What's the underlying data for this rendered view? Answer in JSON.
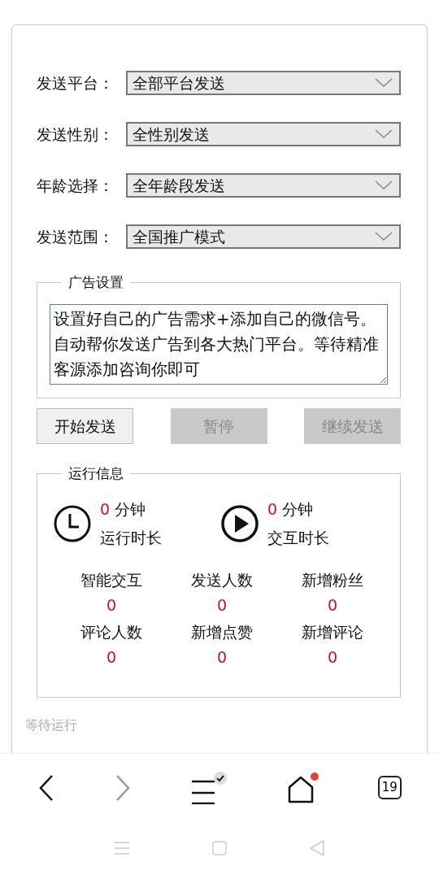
{
  "form": {
    "fields": [
      {
        "label": "发送平台：",
        "value": "全部平台发送"
      },
      {
        "label": "发送性别：",
        "value": "全性别发送"
      },
      {
        "label": "年龄选择：",
        "value": "全年龄段发送"
      },
      {
        "label": "发送范围：",
        "value": "全国推广模式"
      }
    ]
  },
  "ad_settings": {
    "title": "广告设置",
    "text": "设置好自己的广告需求+添加自己的微信号。自动帮你发送广告到各大热门平台。等待精准客源添加咨询你即可"
  },
  "buttons": [
    {
      "label": "开始发送",
      "disabled": false
    },
    {
      "label": "暂停",
      "disabled": true
    },
    {
      "label": "继续发送",
      "disabled": true
    }
  ],
  "run_info": {
    "title": "运行信息",
    "timers": [
      {
        "kind": "clock",
        "value": "0",
        "unit": "分钟",
        "label": "运行时长"
      },
      {
        "kind": "play",
        "value": "0",
        "unit": "分钟",
        "label": "交互时长"
      }
    ],
    "stats": [
      {
        "label": "智能交互",
        "value": "0"
      },
      {
        "label": "发送人数",
        "value": "0"
      },
      {
        "label": "新增粉丝",
        "value": "0"
      },
      {
        "label": "评论人数",
        "value": "0"
      },
      {
        "label": "新增点赞",
        "value": "0"
      },
      {
        "label": "新增评论",
        "value": "0"
      }
    ]
  },
  "status": "等待运行",
  "browser_nav": {
    "back_disabled": false,
    "forward_disabled": true,
    "menu_checked": true,
    "home_notification": true,
    "tab_count": "19"
  }
}
